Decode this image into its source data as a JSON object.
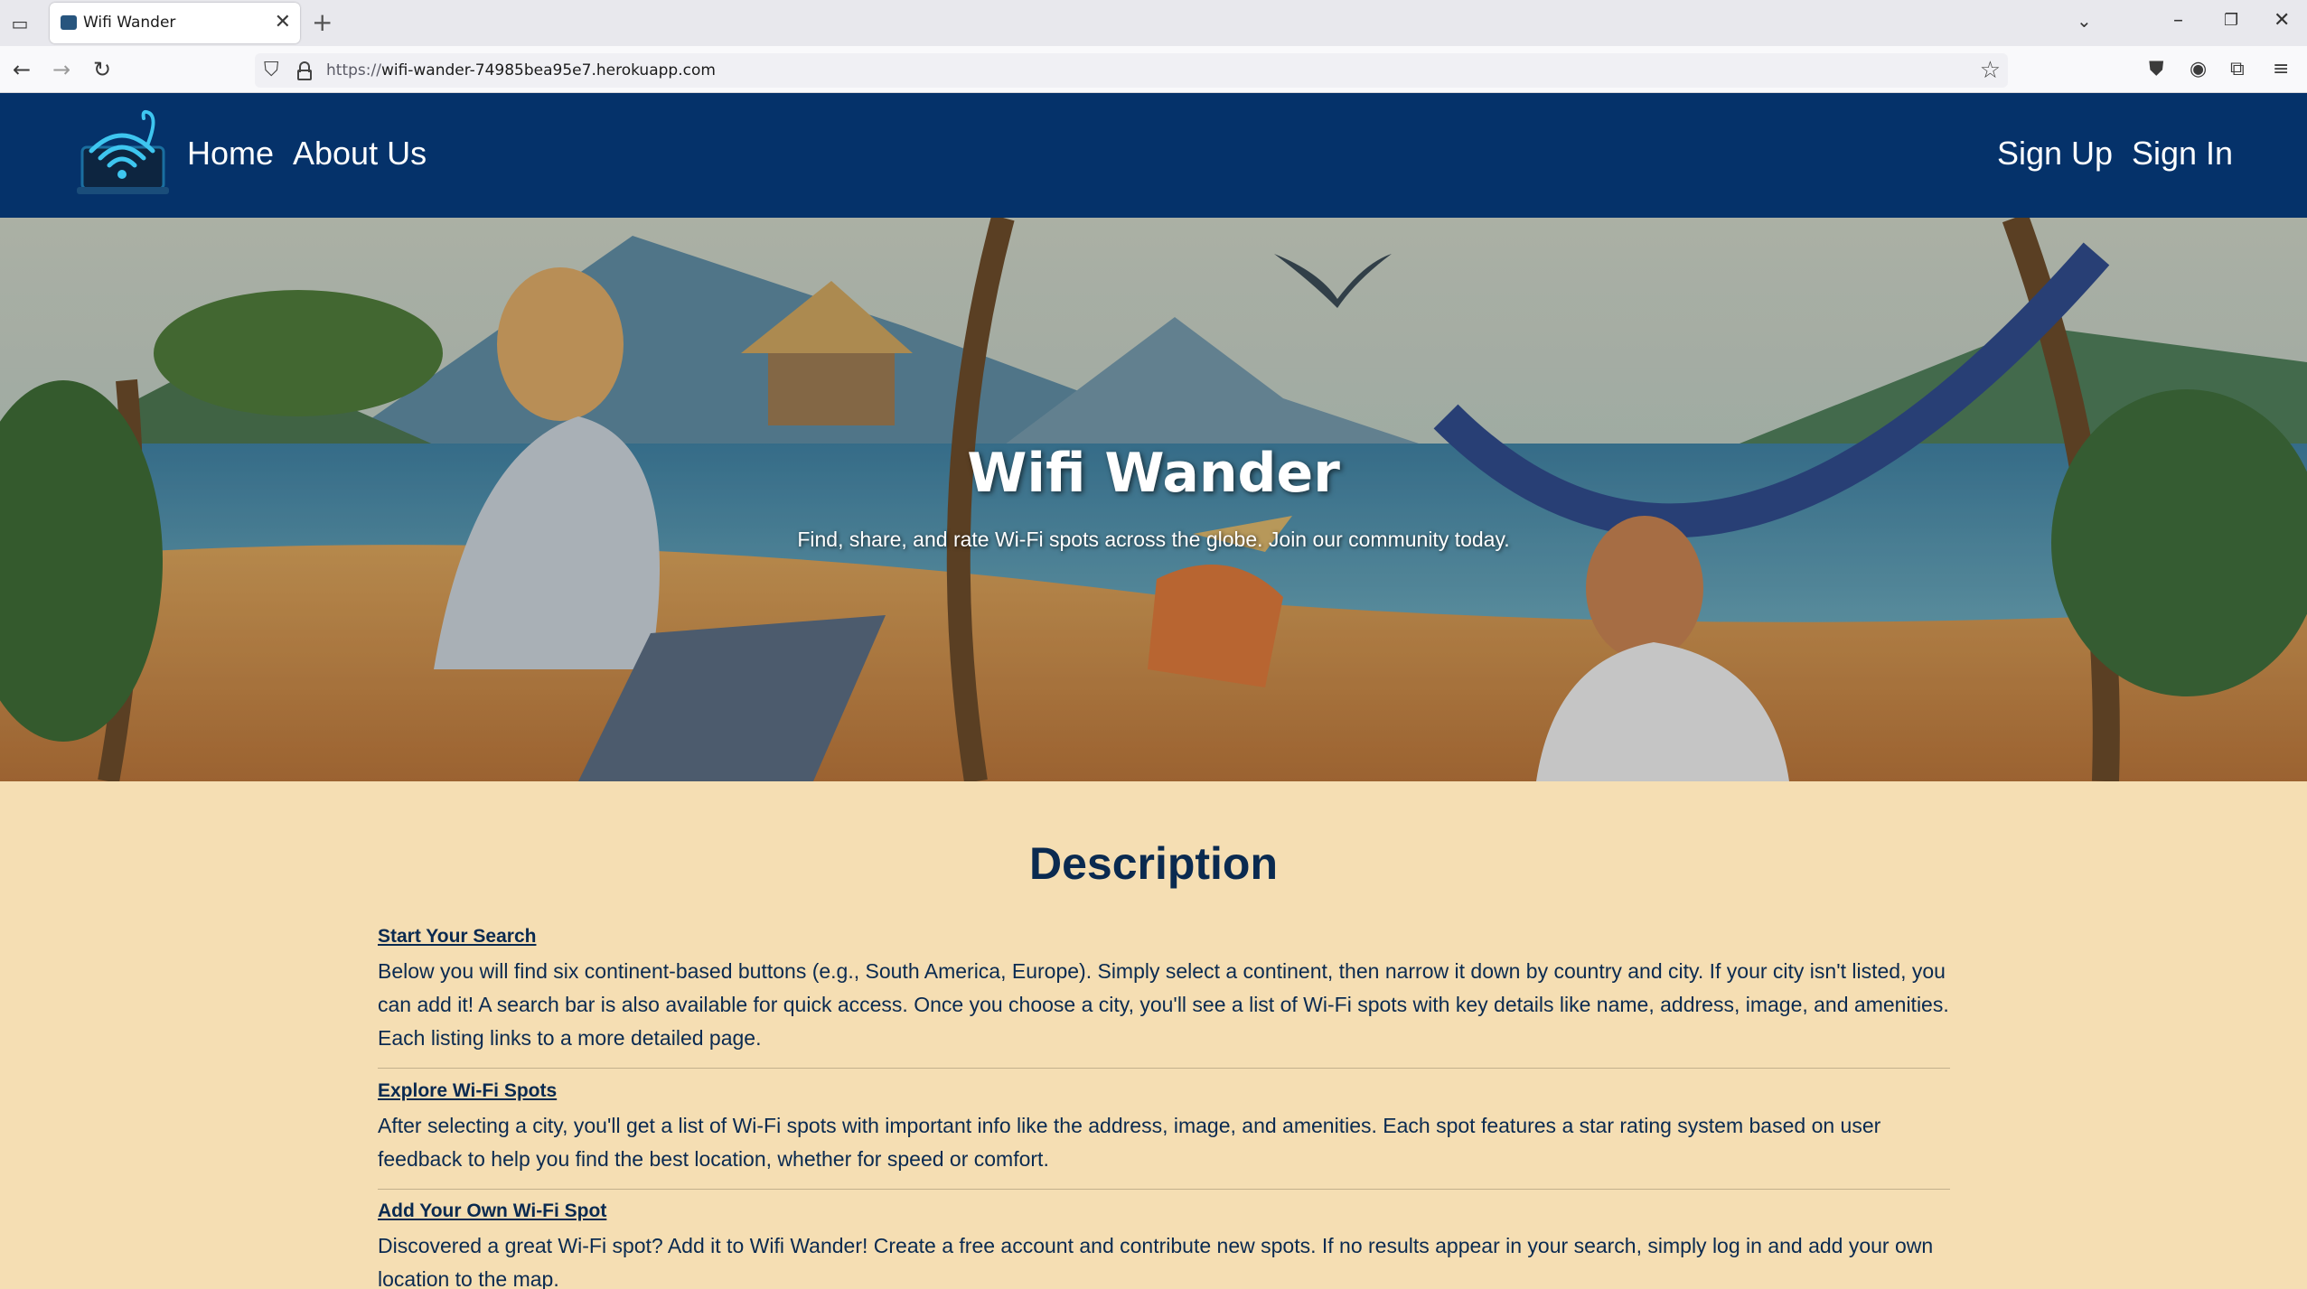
{
  "browser": {
    "tab_title": "Wifi Wander",
    "url_scheme": "https://",
    "url_host": "wifi-wander-74985bea95e7.herokuapp.com"
  },
  "site_nav": {
    "home": "Home",
    "about": "About Us",
    "signup": "Sign Up",
    "signin": "Sign In"
  },
  "hero": {
    "title": "Wifi Wander",
    "subtitle": "Find, share, and rate Wi-Fi spots across the globe. Join our community today."
  },
  "description": {
    "title": "Description",
    "sections": [
      {
        "heading": "Start Your Search",
        "body": "Below you will find six continent-based buttons (e.g., South America, Europe). Simply select a continent, then narrow it down by country and city. If your city isn't listed, you can add it! A search bar is also available for quick access. Once you choose a city, you'll see a list of Wi-Fi spots with key details like name, address, image, and amenities. Each listing links to a more detailed page."
      },
      {
        "heading": "Explore Wi-Fi Spots",
        "body": "After selecting a city, you'll get a list of Wi-Fi spots with important info like the address, image, and amenities. Each spot features a star rating system based on user feedback to help you find the best location, whether for speed or comfort."
      },
      {
        "heading": "Add Your Own Wi-Fi Spot",
        "body": "Discovered a great Wi-Fi spot? Add it to Wifi Wander! Create a free account and contribute new spots. If no results appear in your search, simply log in and add your own location to the map."
      }
    ]
  },
  "colors": {
    "navbar": "#05326a",
    "page_background": "#f5deb3",
    "text_dark": "#0a2a50"
  }
}
